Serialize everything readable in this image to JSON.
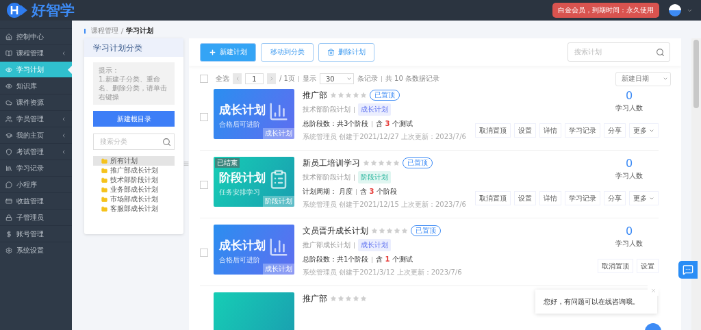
{
  "header": {
    "logo_text": "好智学",
    "membership": "白金会员，到期时间：永久使用"
  },
  "sidebar": {
    "items": [
      {
        "label": "控制中心",
        "has_submenu": false,
        "selected": false
      },
      {
        "label": "课程管理",
        "has_submenu": true,
        "selected": false
      },
      {
        "label": "学习计划",
        "has_submenu": false,
        "selected": true
      },
      {
        "label": "知识库",
        "has_submenu": false,
        "selected": false
      },
      {
        "label": "课件资源",
        "has_submenu": false,
        "selected": false
      },
      {
        "label": "学员管理",
        "has_submenu": true,
        "selected": false
      },
      {
        "label": "我的主页",
        "has_submenu": true,
        "selected": false
      },
      {
        "label": "考试管理",
        "has_submenu": true,
        "selected": false
      },
      {
        "label": "学习记录",
        "has_submenu": false,
        "selected": false
      },
      {
        "label": "小程序",
        "has_submenu": false,
        "selected": false
      },
      {
        "label": "收益管理",
        "has_submenu": false,
        "selected": false
      },
      {
        "label": "子管理员",
        "has_submenu": false,
        "selected": false
      },
      {
        "label": "账号管理",
        "has_submenu": false,
        "selected": false
      },
      {
        "label": "系统设置",
        "has_submenu": false,
        "selected": false
      }
    ]
  },
  "breadcrumb": [
    "课程管理",
    "学习计划"
  ],
  "category_panel": {
    "title": "学习计划分类",
    "hint": "提示：\n1.新建子分类、重命名、删除分类，请单击右键操",
    "new_button": "新建根目录",
    "search_placeholder": "搜索分类",
    "tree": [
      {
        "label": "所有计划",
        "selected": true
      },
      {
        "label": "推广部成长计划",
        "selected": false
      },
      {
        "label": "技术部阶段计划",
        "selected": false
      },
      {
        "label": "业务部成长计划",
        "selected": false
      },
      {
        "label": "市场部成长计划",
        "selected": false
      },
      {
        "label": "客服部成长计划",
        "selected": false
      }
    ]
  },
  "toolbar": {
    "buttons": [
      {
        "label": "新建计划",
        "kind": "primary"
      },
      {
        "label": "移动到分类",
        "kind": "outline"
      },
      {
        "label": "删除计划",
        "kind": "delete"
      }
    ],
    "search_placeholder": "搜索计划"
  },
  "pager": {
    "select_all": "全选",
    "select_all_checked": false,
    "page": "1",
    "pages": "/ 1页",
    "show": "显示",
    "page_size": "30",
    "records": "条记录",
    "total": "共 10 条数据记录",
    "sort": "新建日期"
  },
  "plans": [
    {
      "title": "推广部",
      "stars": 0,
      "pinned": "已置顶",
      "checked": false,
      "thumb": {
        "kind": "growth",
        "title": "成长计划",
        "subtitle": "合格后可进阶",
        "corner": "成长计划"
      },
      "category": "技术部阶段计划",
      "tag": "成长计划",
      "stat_label": "总阶段数：共3个阶段",
      "stat_prefix": "含",
      "stat_count": "3",
      "stat_suffix": "个测试",
      "meta": "系统管理员 创建于2021/12/27 上次更新：2023/7/6",
      "learners": "0",
      "learners_label": "学习人数",
      "actions": [
        "取消置顶",
        "设置",
        "详情",
        "学习记录",
        "分享",
        "更多"
      ]
    },
    {
      "title": "新员工培训学习",
      "stars": 0,
      "pinned": "已置顶",
      "checked": false,
      "thumb": {
        "kind": "stage",
        "title": "阶段计划",
        "subtitle": "任务安排学习",
        "corner": "阶段计划",
        "ended": "已结束"
      },
      "category": "技术部阶段计划",
      "tag": "阶段计划",
      "stat_label": "计划周期： 月度",
      "stat_prefix": "含",
      "stat_count": "3",
      "stat_suffix": "个阶段",
      "meta": "系统管理员 创建于2021/12/15 上次更新：2023/7/6",
      "learners": "0",
      "learners_label": "学习人数",
      "actions": [
        "取消置顶",
        "设置",
        "详情",
        "学习记录",
        "分享",
        "更多"
      ]
    },
    {
      "title": "文员晋升成长计划",
      "stars": 0,
      "pinned": "已置顶",
      "checked": false,
      "thumb": {
        "kind": "growth",
        "title": "成长计划",
        "subtitle": "合格后可进阶",
        "corner": "成长计划"
      },
      "category": "推广部成长计划",
      "tag": "成长计划",
      "stat_label": "总阶段数：共1个阶段",
      "stat_prefix": "含",
      "stat_count": "1",
      "stat_suffix": "个测试",
      "meta": "系统管理员 创建于2021/3/12 上次更新：2023/7/6",
      "learners": "0",
      "learners_label": "学习人数",
      "actions": [
        "取消置顶",
        "设置"
      ]
    },
    {
      "title": "推广部",
      "stars": 0,
      "thumb": {
        "kind": "stage"
      }
    }
  ],
  "chat_popup": {
    "message": "您好，有问题可以在线咨询哦。"
  }
}
